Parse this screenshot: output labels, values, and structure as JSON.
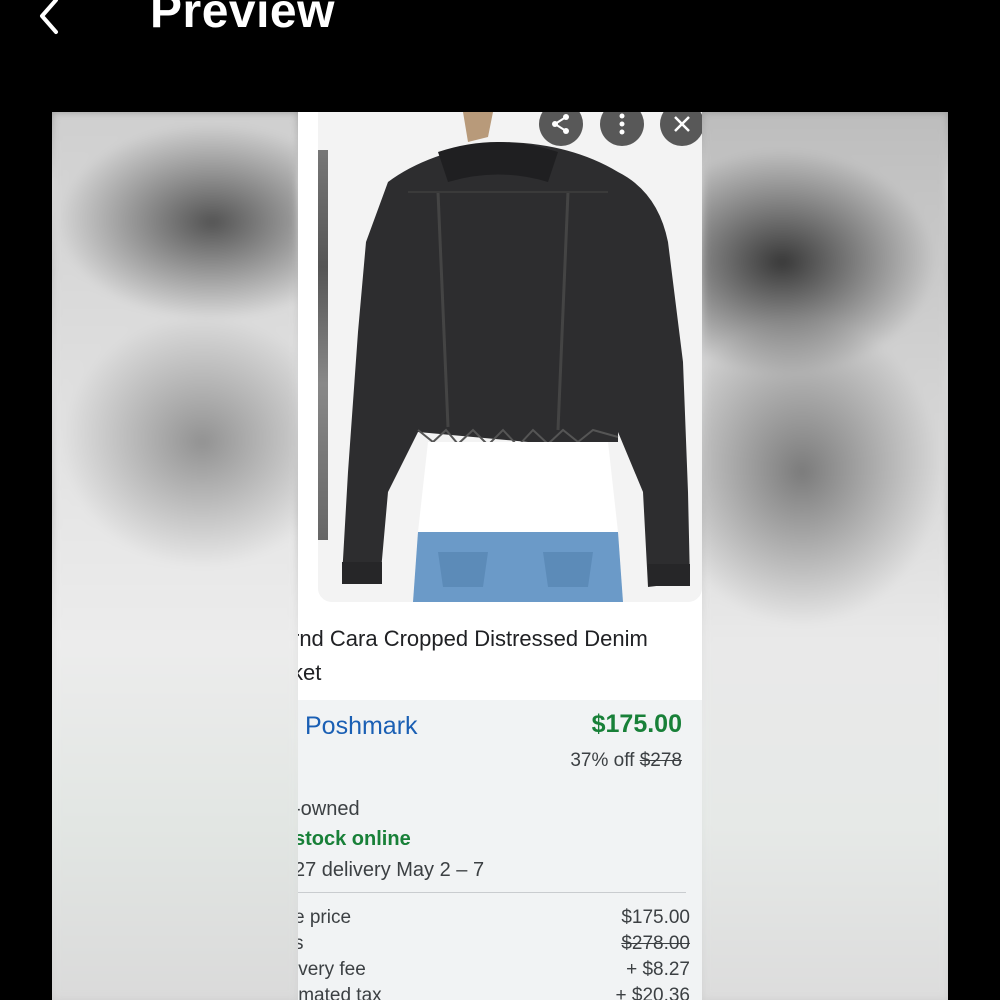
{
  "header": {
    "title": "Preview"
  },
  "product": {
    "title_line1": "rnd Cara Cropped Distressed Denim",
    "title_line2": "ket"
  },
  "offer": {
    "store": "Poshmark",
    "price": "$175.00",
    "discount_text": "37% off ",
    "original_price": "$278",
    "condition": "-owned",
    "stock": "stock online",
    "delivery": " 27 delivery May 2 – 7"
  },
  "breakdown": [
    {
      "label": "e price",
      "value": "$175.00"
    },
    {
      "label": "s",
      "value": "$278.00"
    },
    {
      "label": "ivery fee",
      "value": "+ $8.27"
    },
    {
      "label": "imated tax",
      "value": "+ $20.36"
    }
  ],
  "colors": {
    "price_green": "#188038",
    "store_blue": "#1a5fb4",
    "background": "#000000"
  },
  "icons": [
    "back-arrow-icon",
    "share-icon",
    "more-vert-icon",
    "close-icon"
  ]
}
